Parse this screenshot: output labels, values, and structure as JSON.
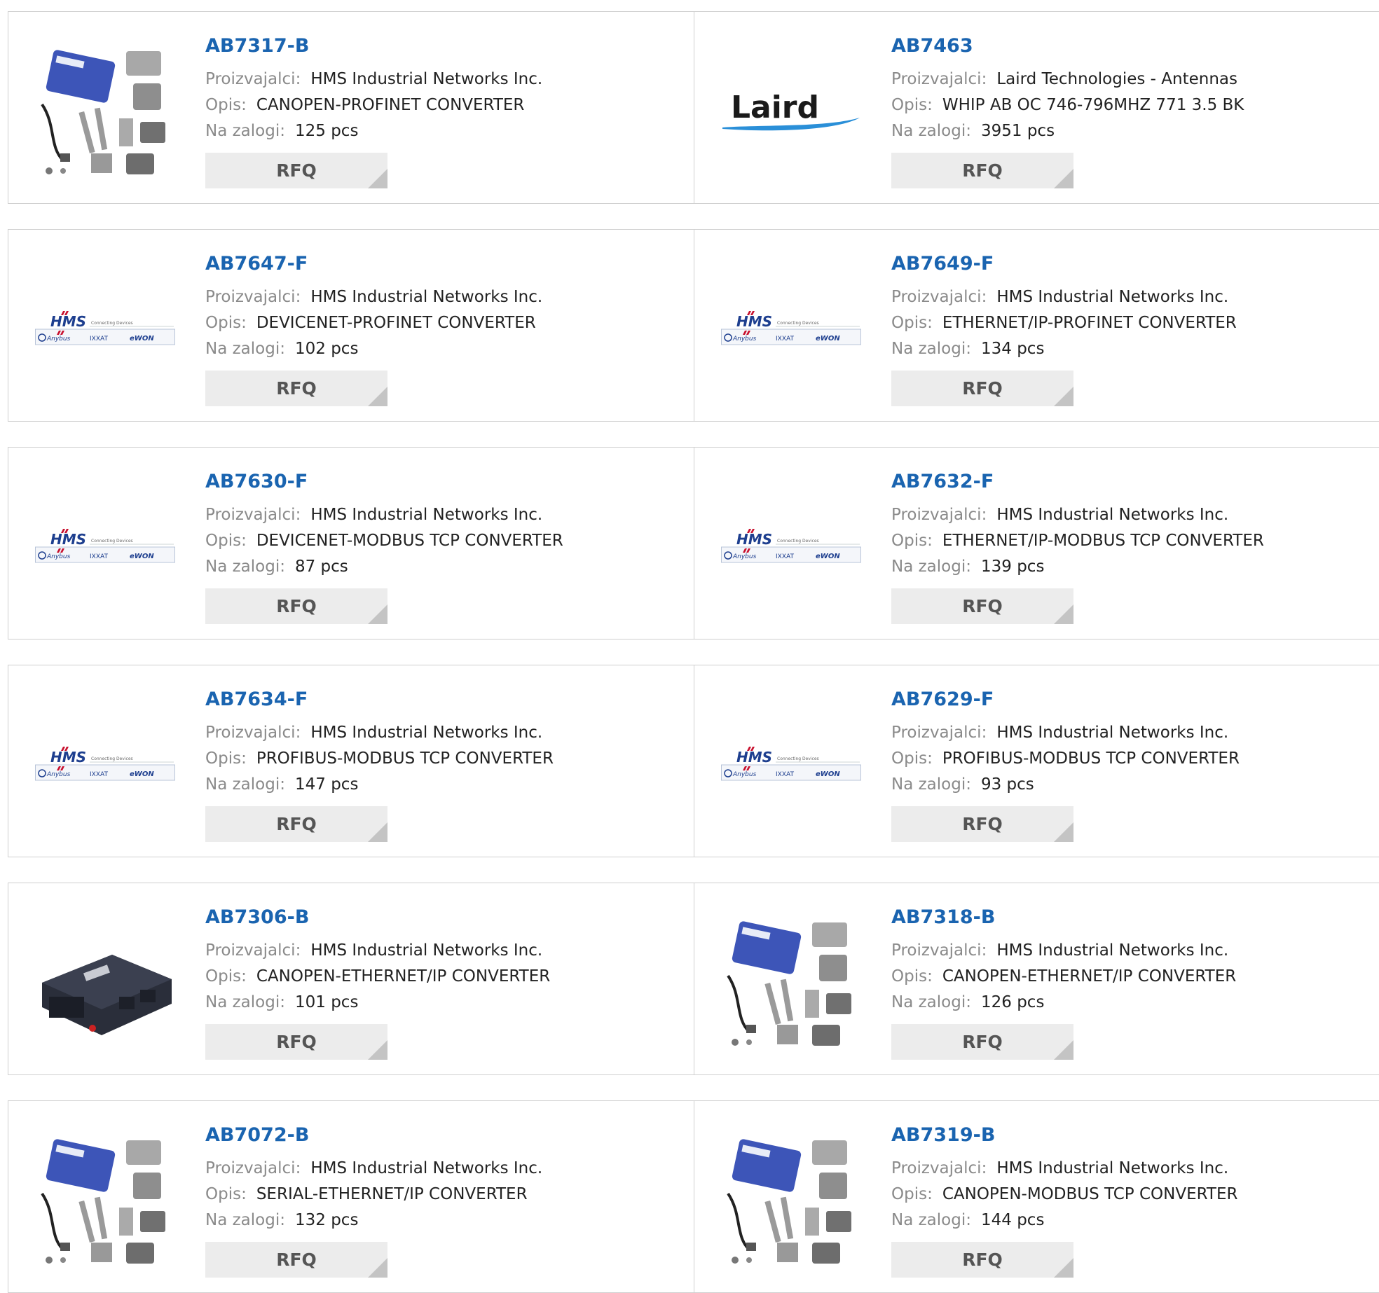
{
  "labels": {
    "manufacturer": "Proizvajalci:",
    "description": "Opis:",
    "stock": "Na zalogi:",
    "rfq": "RFQ"
  },
  "colors": {
    "link": "#1a64b0",
    "button_bg": "#ececec",
    "label": "#8a8a8a"
  },
  "logo_text": {
    "hms": "HMS",
    "hms_tag": "Connecting Devices",
    "anybus": "Anybus",
    "ixxat": "IXXAT",
    "ewon": "eWON",
    "laird": "Laird"
  },
  "products": [
    {
      "pn": "AB7317-B",
      "manufacturer": "HMS Industrial Networks Inc.",
      "description": "CANOPEN-PROFINET CONVERTER",
      "stock": "125 pcs",
      "image": "kit-photo"
    },
    {
      "pn": "AB7463",
      "manufacturer": "Laird Technologies - Antennas",
      "description": "WHIP AB OC 746-796MHZ 771 3.5 BK",
      "stock": "3951 pcs",
      "image": "laird-logo"
    },
    {
      "pn": "AB7647-F",
      "manufacturer": "HMS Industrial Networks Inc.",
      "description": "DEVICENET-PROFINET CONVERTER",
      "stock": "102 pcs",
      "image": "hms-logo"
    },
    {
      "pn": "AB7649-F",
      "manufacturer": "HMS Industrial Networks Inc.",
      "description": "ETHERNET/IP-PROFINET CONVERTER",
      "stock": "134 pcs",
      "image": "hms-logo"
    },
    {
      "pn": "AB7630-F",
      "manufacturer": "HMS Industrial Networks Inc.",
      "description": "DEVICENET-MODBUS TCP CONVERTER",
      "stock": "87 pcs",
      "image": "hms-logo"
    },
    {
      "pn": "AB7632-F",
      "manufacturer": "HMS Industrial Networks Inc.",
      "description": "ETHERNET/IP-MODBUS TCP CONVERTER",
      "stock": "139 pcs",
      "image": "hms-logo"
    },
    {
      "pn": "AB7634-F",
      "manufacturer": "HMS Industrial Networks Inc.",
      "description": "PROFIBUS-MODBUS TCP CONVERTER",
      "stock": "147 pcs",
      "image": "hms-logo"
    },
    {
      "pn": "AB7629-F",
      "manufacturer": "HMS Industrial Networks Inc.",
      "description": "PROFIBUS-MODBUS TCP CONVERTER",
      "stock": "93 pcs",
      "image": "hms-logo"
    },
    {
      "pn": "AB7306-B",
      "manufacturer": "HMS Industrial Networks Inc.",
      "description": "CANOPEN-ETHERNET/IP CONVERTER",
      "stock": "101 pcs",
      "image": "device-photo"
    },
    {
      "pn": "AB7318-B",
      "manufacturer": "HMS Industrial Networks Inc.",
      "description": "CANOPEN-ETHERNET/IP CONVERTER",
      "stock": "126 pcs",
      "image": "kit-photo"
    },
    {
      "pn": "AB7072-B",
      "manufacturer": "HMS Industrial Networks Inc.",
      "description": "SERIAL-ETHERNET/IP CONVERTER",
      "stock": "132 pcs",
      "image": "kit-photo"
    },
    {
      "pn": "AB7319-B",
      "manufacturer": "HMS Industrial Networks Inc.",
      "description": "CANOPEN-MODBUS TCP CONVERTER",
      "stock": "144 pcs",
      "image": "kit-photo"
    }
  ]
}
